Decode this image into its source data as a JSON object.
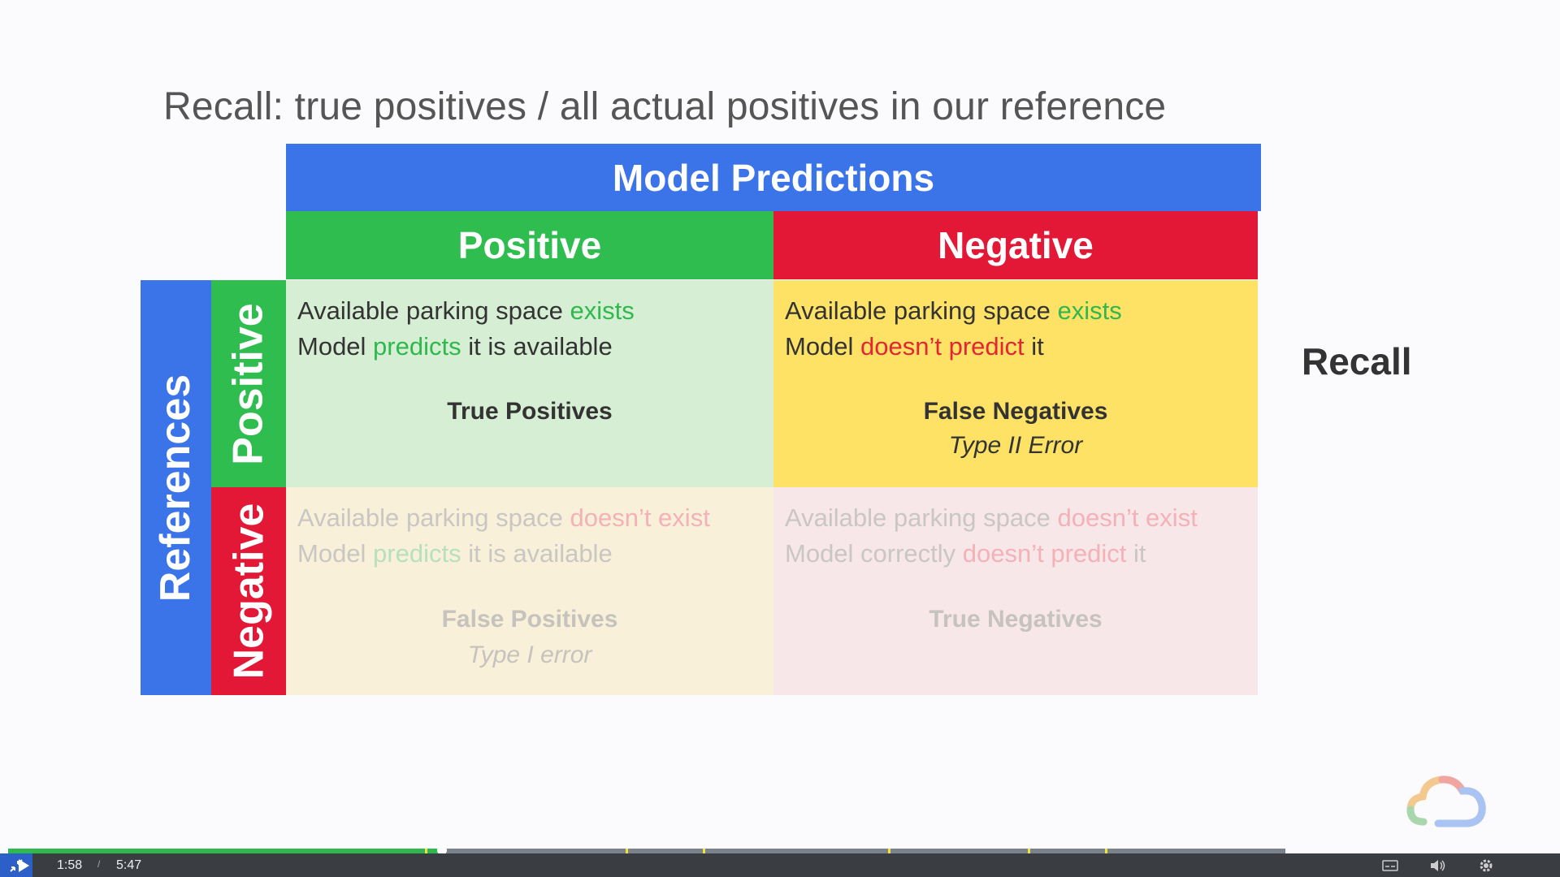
{
  "slide": {
    "title": "Recall: true positives / all actual positives in our reference",
    "model_predictions": "Model Predictions",
    "col_positive": "Positive",
    "col_negative": "Negative",
    "references": "References",
    "row_positive": "Positive",
    "row_negative": "Negative",
    "cells": {
      "tp": {
        "l1_a": "Available parking space ",
        "l1_b": "exists",
        "l2_a": "Model ",
        "l2_b": "predicts",
        "l2_c": " it is available",
        "label": "True Positives"
      },
      "fn": {
        "l1_a": "Available parking space ",
        "l1_b": "exists",
        "l2_a": "Model ",
        "l2_b": "doesn’t predict",
        "l2_c": " it",
        "label": "False Negatives",
        "sub": "Type II Error"
      },
      "fp": {
        "l1_a": "Available parking space ",
        "l1_b": "doesn’t exist",
        "l2_a": "Model ",
        "l2_b": "predicts",
        "l2_c": " it is available",
        "label": "False Positives",
        "sub": "Type I error"
      },
      "tn": {
        "l1_a": "Available parking space ",
        "l1_b": "doesn’t exist",
        "l2_a": "Model correctly ",
        "l2_b": "doesn’t predict",
        "l2_c": " it",
        "label": "True Negatives"
      }
    },
    "recall_label": "Recall",
    "colors": {
      "blue": "#3b73e8",
      "green": "#2fbd50",
      "red": "#e21836",
      "yellow": "#fde265"
    }
  },
  "player": {
    "current_time": "1:58",
    "separator": "/",
    "total_time": "5:47",
    "played_fraction": 0.34,
    "icons": [
      "play-icon",
      "captions-icon",
      "volume-icon",
      "settings-gear-icon",
      "exit-fullscreen-icon"
    ]
  }
}
